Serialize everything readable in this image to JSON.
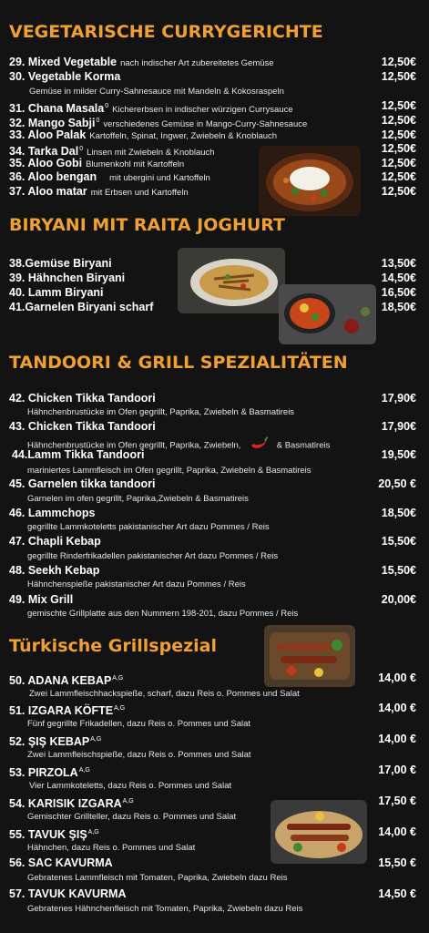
{
  "sections": {
    "vegetarian": "VEGETARISCHE CURRYGERICHTE",
    "biryani": "BIRYANI MIT RAITA JOGHURT",
    "tandoori": "TANDOORI & GRILL SPEZIALITÄTEN",
    "turkish": "Türkische Grillspezial"
  },
  "veg": [
    {
      "name": "29. Mixed Vegetable",
      "sup": "",
      "inline": "nach indischer Art zubereitetes Gemüse",
      "price": "12,50€"
    },
    {
      "name": "30. Vegetable Korma",
      "sup": "",
      "inline": "",
      "price": "12,50€"
    },
    {
      "name": "31. Chana Masala",
      "sup": "0",
      "inline": "Kichererbsen in indischer würzigen Currysauce",
      "price": "12,50€"
    },
    {
      "name": "32. Mango Sabji",
      "sup": "0",
      "inline": "verschiedenes Gemüse in Mango-Curry-Sahnesauce",
      "price": "12,50€"
    },
    {
      "name": "33. Aloo Palak",
      "sup": "",
      "inline": "Kartoffeln, Spinat, Ingwer, Zwiebeln & Knoblauch",
      "price": "12,50€"
    },
    {
      "name": "34. Tarka Dal",
      "sup": "0",
      "inline": "Linsen mit Zwiebeln & Knoblauch",
      "price": "12,50€"
    },
    {
      "name": "35. Aloo Gobi",
      "sup": "",
      "inline": "Blumenkohl mit Kartoffeln",
      "price": "12,50€"
    },
    {
      "name": "36. Aloo bengan",
      "sup": "",
      "inline": "mit ubergini und Kartoffeln",
      "price": "12,50€"
    },
    {
      "name": "37. Aloo matar",
      "sup": "",
      "inline": "mit Erbsen und Kartoffeln",
      "price": "12,50€"
    }
  ],
  "veg_korma_desc": "Gemüse in milder Curry-Sahnesauce mit Mandeln & Kokosraspeln",
  "biryani_items": [
    {
      "name": "38.Gemüse Biryani",
      "price": "13,50€"
    },
    {
      "name": "39. Hähnchen Biryani",
      "price": "14,50€"
    },
    {
      "name": "40. Lamm Biryani",
      "price": "16,50€"
    },
    {
      "name": "41.Garnelen Biryani scharf",
      "price": "18,50€"
    }
  ],
  "tandoori_items": [
    {
      "name": "42. Chicken Tikka Tandoori",
      "price": "17,90€",
      "desc": "Hähnchenbrustücke im Ofen gegrillt, Paprika, Zwiebeln & Basmatireis"
    },
    {
      "name": "43. Chicken Tikka Tandoori",
      "price": "17,90€",
      "desc": "Hähnchenbrustücke im Ofen gegrillt, Paprika, Zwiebeln,",
      "desc2": "& Basmatireis"
    },
    {
      "name": "44.Lamm Tikka Tandoori",
      "price": "19,50€",
      "desc": "mariniertes Lammfleisch im Ofen gegrillt, Paprika, Zwiebeln & Basmatireis"
    },
    {
      "name": "45. Garnelen tikka tandoori",
      "price": "20,50 €",
      "desc": "Garnelen im ofen gegrillt, Paprika,Zwiebeln & Basmatireis"
    },
    {
      "name": "46. Lammchops",
      "price": "18,50€",
      "desc": "gegrillte Lammkoteletts pakistanischer Art dazu Pommes / Reis"
    },
    {
      "name": "47. Chapli Kebap",
      "price": "15,50€",
      "desc": "gegrillte Rinderfrikadellen pakistanischer Art dazu Pommes / Reis"
    },
    {
      "name": "48. Seekh Kebap",
      "price": "15,50€",
      "desc": "Hähnchenspieße pakistanischer Art dazu Pommes / Reis"
    },
    {
      "name": "49. Mix  Grill",
      "price": "20,00€",
      "desc": "gemischte Grillplatte aus den Nummern 198-201, dazu Pommes / Reis"
    }
  ],
  "turkish_items": [
    {
      "name": "50. ADANA KEBAP",
      "sup": "A,G",
      "price": "14,00 €",
      "desc": "Zwei Lammfleischhackspieße, scharf, dazu Reis o. Pommes und Salat"
    },
    {
      "name": "51. IZGARA KÖFTE",
      "sup": "A,G",
      "price": "14,00 €",
      "desc": "Fünf gegrillte Frikadellen, dazu Reis o. Pommes und Salat"
    },
    {
      "name": "52. ŞIŞ KEBAP",
      "sup": "A,G",
      "price": "14,00 €",
      "desc": "Zwei Lammfleischspieße, dazu Reis o. Pommes und Salat"
    },
    {
      "name": "53. PIRZOLA",
      "sup": "A,G",
      "price": "17,00 €",
      "desc": "Vier Lammkoteletts, dazu Reis o. Pommes und Salat"
    },
    {
      "name": "54. KARISIK IZGARA",
      "sup": "A,G",
      "price": "17,50 €",
      "desc": "Gemischter Grillteller, dazu Reis o. Pommes und Salat"
    },
    {
      "name": "55. TAVUK ŞIŞ",
      "sup": "A,G",
      "price": "14,00 €",
      "desc": "Hähnchen, dazu Reis o. Pommes und Salat"
    },
    {
      "name": "56. SAC KAVURMA",
      "sup": "",
      "price": "15,50 €",
      "desc": "Gebratenes Lammfleisch mit Tomaten, Paprika, Zwiebeln dazu Reis"
    },
    {
      "name": "57. TAVUK KAVURMA",
      "sup": "",
      "price": "14,50 €",
      "desc": "Gebratenes Hähnchenfleisch mit Tomaten, Paprika, Zwiebeln dazu Reis"
    }
  ],
  "icons": {
    "chili": "chili-pepper-icon"
  },
  "colors": {
    "accent": "#f0a030",
    "background": "#131313"
  }
}
